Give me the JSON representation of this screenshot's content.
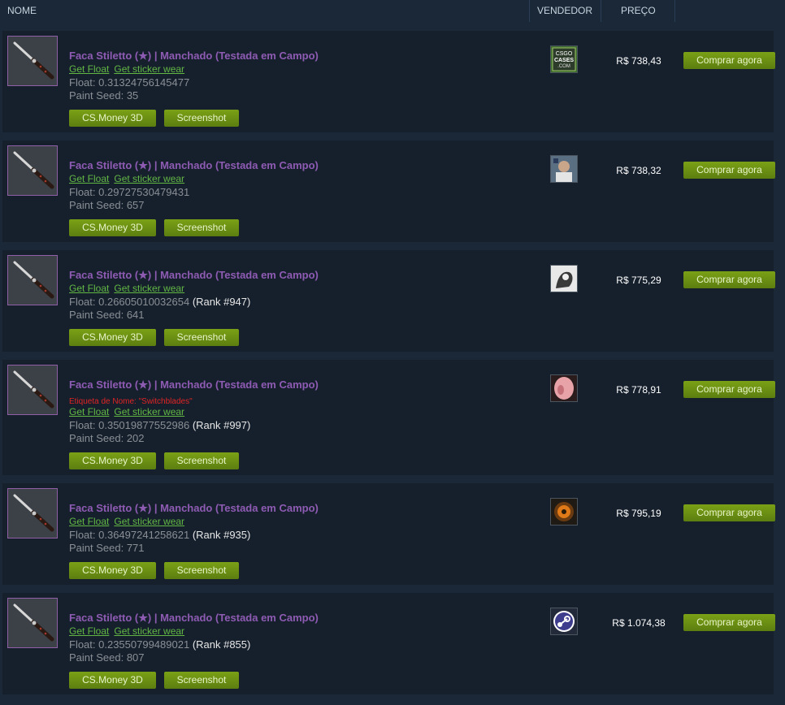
{
  "header": {
    "name": "NOME",
    "seller": "VENDEDOR",
    "price": "PREÇO"
  },
  "labels": {
    "get_float": "Get Float",
    "get_sticker_wear": "Get sticker wear",
    "float_prefix": "Float: ",
    "seed_prefix": "Paint Seed: ",
    "csmoney": "CS.Money 3D",
    "screenshot": "Screenshot",
    "buy": "Comprar agora"
  },
  "listings": [
    {
      "title": "Faca Stiletto (★) | Manchado (Testada em Campo)",
      "nametag": "",
      "float": "0.31324756145477",
      "rank": "",
      "seed": "35",
      "seller": "csgocases-logo",
      "seller_text": [
        "CSGO",
        "CASES",
        ".COM"
      ],
      "price": "R$ 738,43"
    },
    {
      "title": "Faca Stiletto (★) | Manchado (Testada em Campo)",
      "nametag": "",
      "float": "0.29727530479431",
      "rank": "",
      "seed": "657",
      "seller": "person-avatar",
      "price": "R$ 738,32"
    },
    {
      "title": "Faca Stiletto (★) | Manchado (Testada em Campo)",
      "nametag": "",
      "float": "0.26605010032654",
      "rank": "(Rank #947)",
      "seed": "641",
      "seller": "sketch-avatar",
      "price": "R$ 775,29"
    },
    {
      "title": "Faca Stiletto (★) | Manchado (Testada em Campo)",
      "nametag": "Etiqueta de Nome: \"Switchblades\"",
      "float": "0.35019877552986",
      "rank": "(Rank #997)",
      "seed": "202",
      "seller": "pink-avatar",
      "price": "R$ 778,91"
    },
    {
      "title": "Faca Stiletto (★) | Manchado (Testada em Campo)",
      "nametag": "",
      "float": "0.36497241258621",
      "rank": "(Rank #935)",
      "seed": "771",
      "seller": "orange-emblem-avatar",
      "price": "R$ 795,19"
    },
    {
      "title": "Faca Stiletto (★) | Manchado (Testada em Campo)",
      "nametag": "",
      "float": "0.23550799489021",
      "rank": "(Rank #855)",
      "seed": "807",
      "seller": "steam-logo-avatar",
      "price": "R$ 1.074,38"
    }
  ]
}
